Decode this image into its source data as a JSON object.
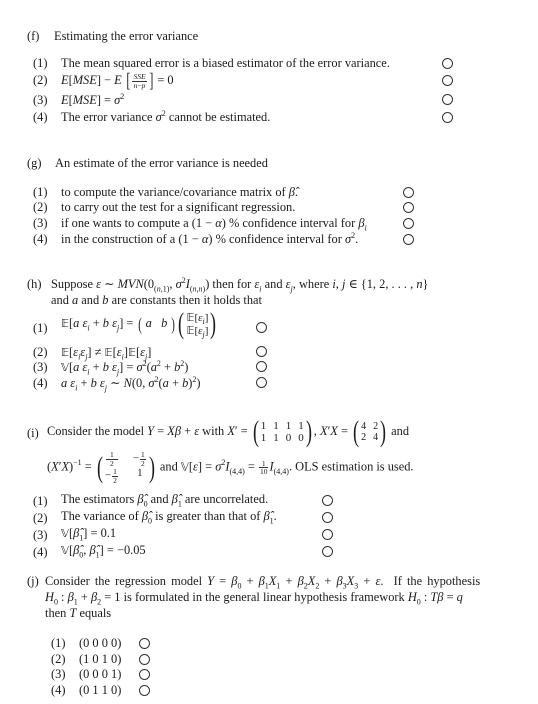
{
  "questions": [
    {
      "id": "f",
      "label": "(f)",
      "stem": "Estimating the error variance",
      "options": [
        {
          "num": "(1)",
          "text": "The mean squared error is a biased estimator of the error variance."
        },
        {
          "num": "(2)",
          "text": "E[MSE] − E[SSE/(n−p)] = 0"
        },
        {
          "num": "(3)",
          "text": "E[MSE] = σ²"
        },
        {
          "num": "(4)",
          "text": "The error variance σ² cannot be estimated."
        }
      ]
    },
    {
      "id": "g",
      "label": "(g)",
      "stem": "An estimate of the error variance is needed",
      "options": [
        {
          "num": "(1)",
          "text": "to compute the variance/covariance matrix of β̂."
        },
        {
          "num": "(2)",
          "text": "to carry out the test for a significant regression."
        },
        {
          "num": "(3)",
          "text": "if one wants to compute a (1 − α) % confidence interval for βi"
        },
        {
          "num": "(4)",
          "text": "in the construction of a (1 − α) % confidence interval for σ²."
        }
      ]
    },
    {
      "id": "h",
      "label": "(h)",
      "stem_line1": "Suppose ε ∼ MVN(0(n,1), σ²I(n,n)) then for εi and εj, where i, j ∈ {1, 2, . . . , n}",
      "stem_line2": "and a and b are constants then it holds that",
      "options": [
        {
          "num": "(1)",
          "text": "E[a εi + b εj] = (a b)(E[εi]; E[εj])"
        },
        {
          "num": "(2)",
          "text": "E[εiεj] ≠ E[εi]E[εj]"
        },
        {
          "num": "(3)",
          "text": "V[a εi + b εj] = σ²(a² + b²)"
        },
        {
          "num": "(4)",
          "text": "a εi + b εj ∼ N(0, σ²(a + b)²)"
        }
      ]
    },
    {
      "id": "i",
      "label": "(i)",
      "stem_line1": "Consider the model Y = Xβ + ε with X′ = (1 1 1 1; 1 1 0 0), X′X = (4 2; 2 4) and",
      "stem_line2": "(X′X)⁻¹ = (1/2 −1/2; −1/2 1) and V[ε] = σ²I(4,4) = 1/10 I(4,4). OLS estimation is used.",
      "options": [
        {
          "num": "(1)",
          "text": "The estimators β̂0 and β̂1 are uncorrelated."
        },
        {
          "num": "(2)",
          "text": "The variance of β̂0 is greater than that of β̂1."
        },
        {
          "num": "(3)",
          "text": "V[β̂1] = 0.1"
        },
        {
          "num": "(4)",
          "text": "V[β̂0, β̂1] = −0.05"
        }
      ]
    },
    {
      "id": "j",
      "label": "(j)",
      "stem_line1": "Consider the regression model Y = β0 + β1X1 + β2X2 + β3X3 + ε. If the hypothesis",
      "stem_line2": "H0 : β1 + β2 = 1 is formulated in the general linear hypothesis framework H0 : Tβ = q",
      "stem_line3": "then T equals",
      "options": [
        {
          "num": "(1)",
          "text": "(0 0 0 0)"
        },
        {
          "num": "(2)",
          "text": "(1 0 1 0)"
        },
        {
          "num": "(3)",
          "text": "(0 0 0 1)"
        },
        {
          "num": "(4)",
          "text": "(0 1 1 0)"
        }
      ]
    }
  ],
  "math": {
    "X_prime": [
      [
        "1",
        "1",
        "1",
        "1"
      ],
      [
        "1",
        "1",
        "0",
        "0"
      ]
    ],
    "XtX": [
      [
        "4",
        "2"
      ],
      [
        "2",
        "4"
      ]
    ],
    "XtX_inv": [
      [
        "1/2",
        "−1/2"
      ],
      [
        "−1/2",
        "1"
      ]
    ],
    "variance_scalar": "1/10"
  }
}
